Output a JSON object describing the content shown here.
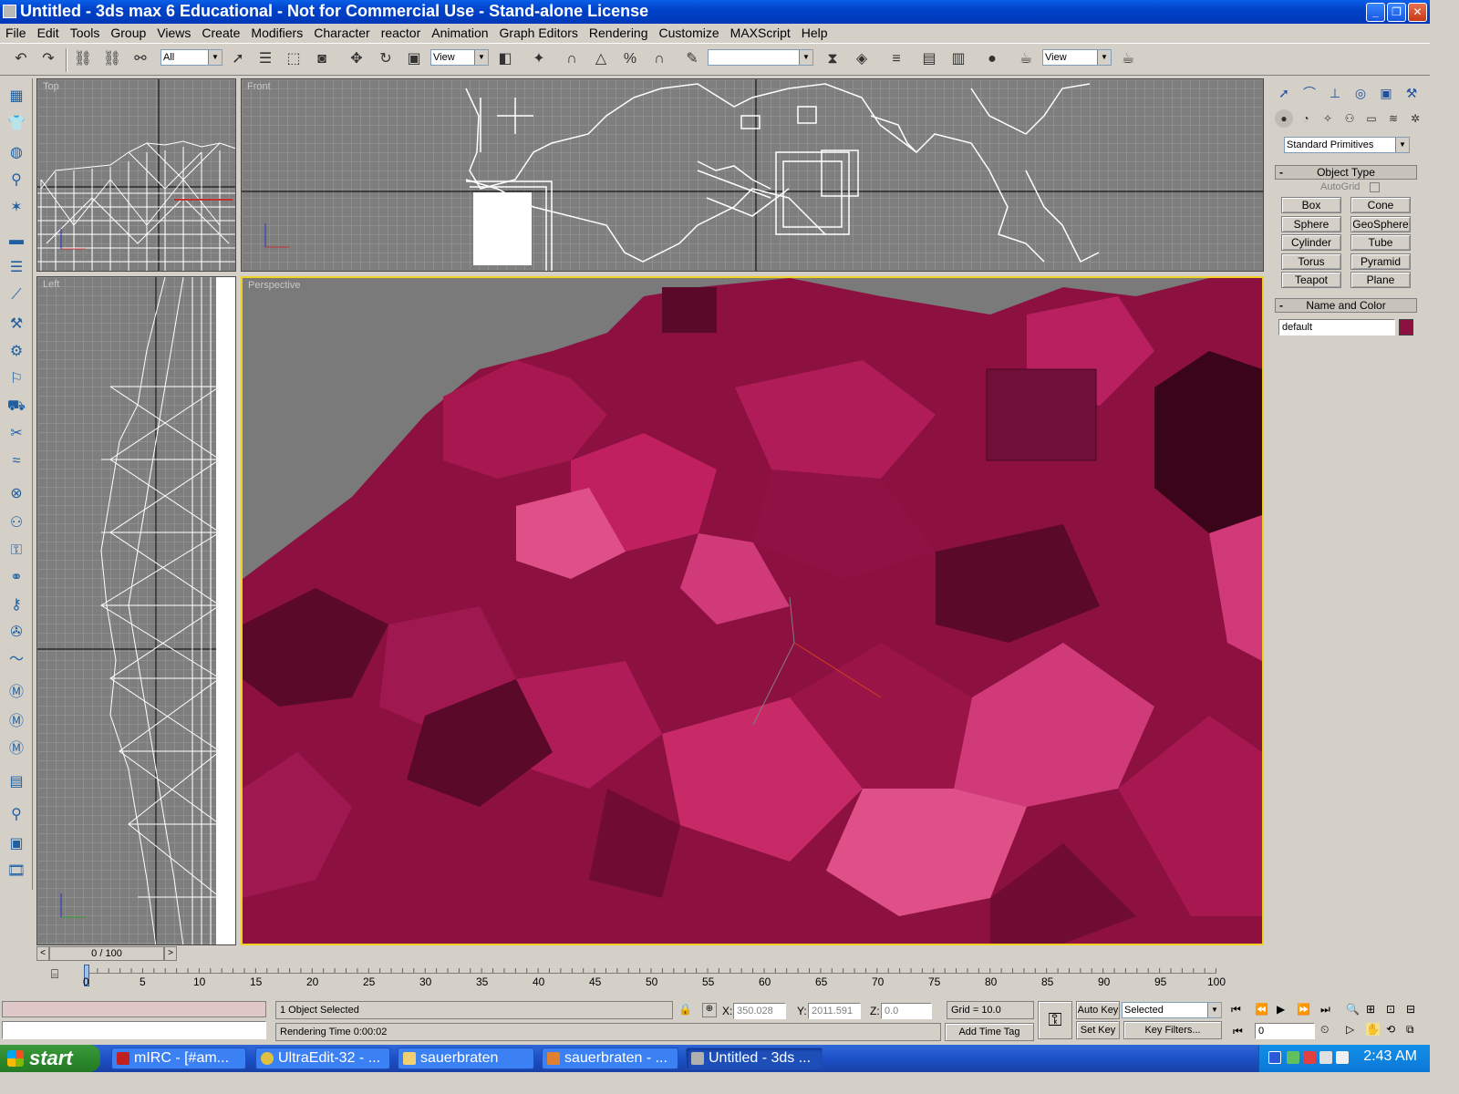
{
  "window": {
    "title": "Untitled - 3ds max 6 Educational - Not for Commercial Use - Stand-alone License"
  },
  "menu": [
    "File",
    "Edit",
    "Tools",
    "Group",
    "Views",
    "Create",
    "Modifiers",
    "Character",
    "reactor",
    "Animation",
    "Graph Editors",
    "Rendering",
    "Customize",
    "MAXScript",
    "Help"
  ],
  "toolbar": {
    "selection_filter": "All",
    "ref_coord_1": "View",
    "named_selection": "",
    "ref_coord_2": "View"
  },
  "viewports": {
    "top": "Top",
    "front": "Front",
    "left": "Left",
    "perspective": "Perspective"
  },
  "command_panel": {
    "category": "Standard Primitives",
    "object_type_title": "Object Type",
    "autogrid": "AutoGrid",
    "primitives": [
      "Box",
      "Cone",
      "Sphere",
      "GeoSphere",
      "Cylinder",
      "Tube",
      "Torus",
      "Pyramid",
      "Teapot",
      "Plane"
    ],
    "name_color_title": "Name and Color",
    "object_name": "default",
    "object_color": "#8c1040"
  },
  "time_slider": {
    "frame": "0 / 100"
  },
  "trackbar": {
    "ticks": [
      "0",
      "5",
      "10",
      "15",
      "20",
      "25",
      "30",
      "35",
      "40",
      "45",
      "50",
      "55",
      "60",
      "65",
      "70",
      "75",
      "80",
      "85",
      "90",
      "95",
      "100"
    ]
  },
  "status": {
    "selection": "1 Object Selected",
    "prompt": "Rendering Time  0:00:02",
    "x_label": "X:",
    "x_value": "350.028",
    "y_label": "Y:",
    "y_value": "2011.591",
    "z_label": "Z:",
    "z_value": "0.0",
    "grid": "Grid = 10.0",
    "add_time_tag": "Add Time Tag",
    "auto_key": "Auto Key",
    "set_key": "Set Key",
    "key_mode": "Selected",
    "key_filters": "Key Filters...",
    "current_frame": "0"
  },
  "taskbar": {
    "start": "start",
    "tasks": [
      "mIRC - [#am...",
      "UltraEdit-32 - ...",
      "sauerbraten",
      "sauerbraten - ...",
      "Untitled - 3ds ..."
    ],
    "clock": "2:43 AM"
  },
  "colors": {
    "terrain": "#8c1040",
    "active_viewport_border": "#f0d020",
    "viewport_bg": "#7e7e7e"
  }
}
